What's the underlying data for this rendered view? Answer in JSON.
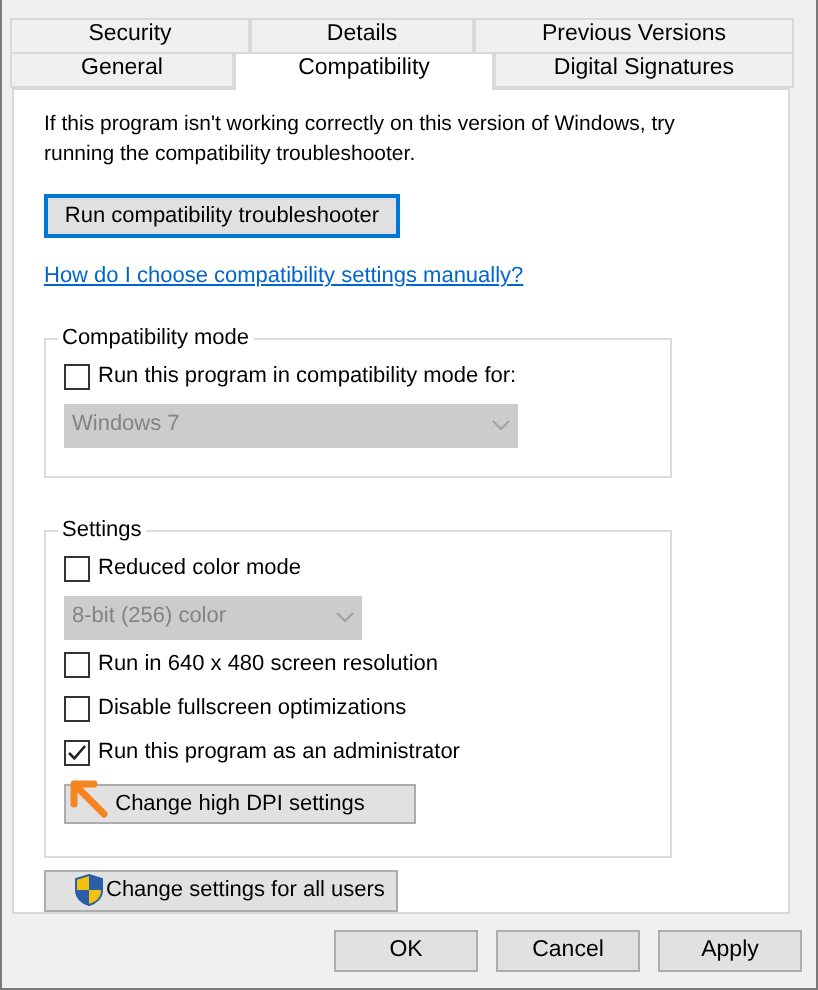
{
  "tabs": [
    {
      "label": "Security",
      "selected": false
    },
    {
      "label": "Details",
      "selected": false
    },
    {
      "label": "Previous Versions",
      "selected": false
    },
    {
      "label": "General",
      "selected": false
    },
    {
      "label": "Compatibility",
      "selected": true
    },
    {
      "label": "Digital Signatures",
      "selected": false
    }
  ],
  "intro": "If this program isn't working correctly on this version of Windows, try running the compatibility troubleshooter.",
  "troubleshooter_button": "Run compatibility troubleshooter",
  "help_link": "How do I choose compatibility settings manually?",
  "groups": [
    {
      "title": "Compatibility mode",
      "items": [
        {
          "kind": "checkbox",
          "label": "Run this program in compatibility mode for:",
          "checked": false
        },
        {
          "kind": "dropdown",
          "value": "Windows 7",
          "disabled": true
        }
      ]
    },
    {
      "title": "Settings",
      "items": [
        {
          "kind": "checkbox",
          "label": "Reduced color mode",
          "checked": false
        },
        {
          "kind": "dropdown",
          "value": "8-bit (256) color",
          "disabled": true
        },
        {
          "kind": "checkbox",
          "label": "Run in 640 x 480 screen resolution",
          "checked": false
        },
        {
          "kind": "checkbox",
          "label": "Disable fullscreen optimizations",
          "checked": false
        },
        {
          "kind": "checkbox",
          "label": "Run this program as an administrator",
          "checked": true
        },
        {
          "kind": "button",
          "label": "Change high DPI settings"
        }
      ]
    }
  ],
  "all_users_button": "Change settings for all users",
  "dialog_buttons": [
    "OK",
    "Cancel",
    "Apply"
  ]
}
